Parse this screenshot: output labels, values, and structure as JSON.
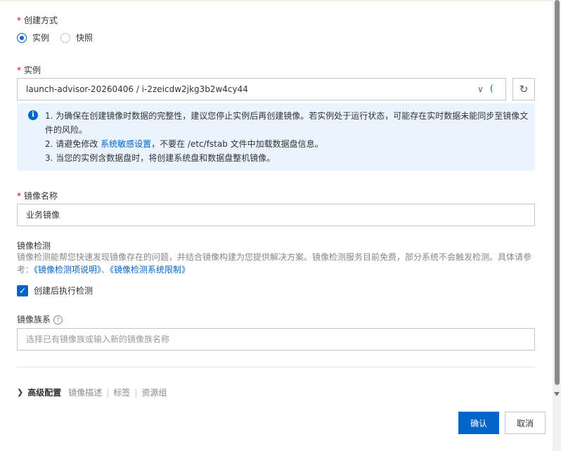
{
  "create_method": {
    "label": "创建方式",
    "options": [
      {
        "label": "实例",
        "selected": true
      },
      {
        "label": "快照",
        "selected": false
      }
    ]
  },
  "instance": {
    "label": "实例",
    "value": "launch-advisor-20260406 / i-2zeicdw2jkg3b2w4cy44",
    "chevron": "∨",
    "loading": "("
  },
  "notice": {
    "line1": "1. 为确保在创建镜像时数据的完整性，建议您停止实例后再创建镜像。若实例处于运行状态，可能存在实时数据未能同步至镜像文件的风险。",
    "line2_prefix": "2. 请避免修改",
    "line2_link": "系统敏感设置",
    "line2_suffix": "，不要在 /etc/fstab 文件中加载数据盘信息。",
    "line3": "3. 当您的实例含数据盘时，将创建系统盘和数据盘整机镜像。"
  },
  "image_name": {
    "label": "镜像名称",
    "value": "业务镜像"
  },
  "image_check": {
    "label": "镜像检测",
    "description": "镜像检测能帮您快速发现镜像存在的问题，并结合镜像构建为您提供解决方案。镜像检测服务目前免费，部分系统不会触发检测。具体请参考：",
    "link1": "《镜像检测项说明》",
    "separator": "、",
    "link2": "《镜像检测系统限制》",
    "checkbox_label": "创建后执行检测",
    "checked": true
  },
  "image_family": {
    "label": "镜像族系",
    "placeholder": "选择已有镜像族或输入新的镜像族名称"
  },
  "advanced": {
    "title": "高级配置",
    "items": [
      "镜像描述",
      "标签",
      "资源组"
    ]
  },
  "buttons": {
    "confirm": "确认",
    "cancel": "取消"
  },
  "colors": {
    "primary": "#0064c8",
    "required": "#d0021b",
    "notice_bg": "#e9f4ff"
  }
}
